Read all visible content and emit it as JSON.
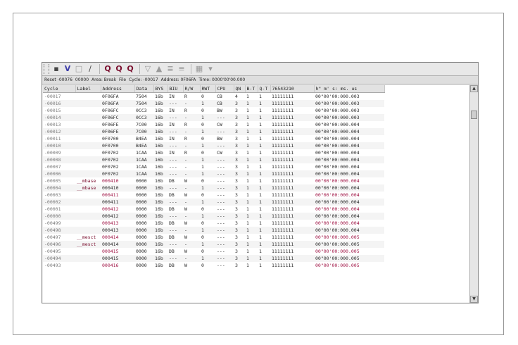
{
  "toolbar": {
    "items": [
      {
        "name": "pointer-tool-icon",
        "glyph": "▪",
        "cls": "",
        "interactable": true
      },
      {
        "name": "v-tool-icon",
        "glyph": "V",
        "cls": "v",
        "interactable": true
      },
      {
        "name": "page-icon",
        "glyph": "□",
        "cls": "dis",
        "interactable": true
      },
      {
        "name": "pencil-icon",
        "glyph": "∕",
        "cls": "",
        "interactable": true
      },
      {
        "sep": true
      },
      {
        "name": "search-icon",
        "glyph": "Q",
        "cls": "mag",
        "interactable": true
      },
      {
        "name": "search-prev-icon",
        "glyph": "Q",
        "cls": "mag",
        "interactable": true
      },
      {
        "name": "search-next-icon",
        "glyph": "Q",
        "cls": "mag",
        "interactable": true
      },
      {
        "sep": true
      },
      {
        "name": "filter-down-icon",
        "glyph": "▽",
        "cls": "dis",
        "interactable": true
      },
      {
        "name": "triangle-up-icon",
        "glyph": "▲",
        "cls": "dis",
        "interactable": true
      },
      {
        "name": "filter-lines-icon",
        "glyph": "≣",
        "cls": "dis",
        "interactable": true
      },
      {
        "name": "list-icon",
        "glyph": "≡",
        "cls": "dis",
        "interactable": true
      },
      {
        "sep": true
      },
      {
        "name": "grid-icon",
        "glyph": "▦",
        "cls": "dis",
        "interactable": true
      },
      {
        "name": "dropdown-icon",
        "glyph": "▾",
        "cls": "dis",
        "interactable": true
      }
    ]
  },
  "status": [
    "Reset -00076",
    "00000",
    "Area: Break",
    "File",
    "Cycle: -00017",
    "Address: 0F06FA",
    "Time: 0000'00'00.000"
  ],
  "columns": [
    "Cycle",
    "Label",
    "Address",
    "Data",
    "BYS",
    "BIU",
    "R/W",
    "RWT",
    "CPU",
    "QN",
    "B-T",
    "Q-T",
    "76543210",
    "h\" m' s: ms. us"
  ],
  "rows": [
    {
      "cycle": "-00017",
      "label": "",
      "address": "0F06FA",
      "data": "7504",
      "bys": "16b",
      "biu": "IN",
      "rw": "R",
      "rwt": "0",
      "cpu": "CB",
      "qn": "4",
      "bt": "1",
      "qt": "1",
      "bits": "11111111",
      "time": "00\"00'00:000.003",
      "hl": false
    },
    {
      "cycle": "-00016",
      "label": "",
      "address": "0F06FA",
      "data": "7504",
      "bys": "16b",
      "biu": "---",
      "rw": "-",
      "rwt": "1",
      "cpu": "CB",
      "qn": "3",
      "bt": "1",
      "qt": "1",
      "bits": "11111111",
      "time": "00\"00'00:000.003",
      "hl": false
    },
    {
      "cycle": "-00015",
      "label": "",
      "address": "0F06FC",
      "data": "0CC3",
      "bys": "16b",
      "biu": "IN",
      "rw": "R",
      "rwt": "0",
      "cpu": "BW",
      "qn": "3",
      "bt": "1",
      "qt": "1",
      "bits": "11111111",
      "time": "00\"00'00:000.003",
      "hl": false
    },
    {
      "cycle": "-00014",
      "label": "",
      "address": "0F06FC",
      "data": "0CC3",
      "bys": "16b",
      "biu": "---",
      "rw": "-",
      "rwt": "1",
      "cpu": "---",
      "qn": "3",
      "bt": "1",
      "qt": "1",
      "bits": "11111111",
      "time": "00\"00'00:000.003",
      "hl": false
    },
    {
      "cycle": "-00013",
      "label": "",
      "address": "0F06FE",
      "data": "7C00",
      "bys": "16b",
      "biu": "IN",
      "rw": "R",
      "rwt": "0",
      "cpu": "CW",
      "qn": "3",
      "bt": "1",
      "qt": "1",
      "bits": "11111111",
      "time": "00\"00'00:000.004",
      "hl": false
    },
    {
      "cycle": "-00012",
      "label": "",
      "address": "0F06FE",
      "data": "7C00",
      "bys": "16b",
      "biu": "---",
      "rw": "-",
      "rwt": "1",
      "cpu": "---",
      "qn": "3",
      "bt": "1",
      "qt": "1",
      "bits": "11111111",
      "time": "00\"00'00:000.004",
      "hl": false
    },
    {
      "cycle": "-00011",
      "label": "",
      "address": "0F0700",
      "data": "B4EA",
      "bys": "16b",
      "biu": "IN",
      "rw": "R",
      "rwt": "0",
      "cpu": "BW",
      "qn": "3",
      "bt": "1",
      "qt": "1",
      "bits": "11111111",
      "time": "00\"00'00:000.004",
      "hl": false
    },
    {
      "cycle": "-00010",
      "label": "",
      "address": "0F0700",
      "data": "B4EA",
      "bys": "16b",
      "biu": "---",
      "rw": "-",
      "rwt": "1",
      "cpu": "---",
      "qn": "3",
      "bt": "1",
      "qt": "1",
      "bits": "11111111",
      "time": "00\"00'00:000.004",
      "hl": false
    },
    {
      "cycle": "-00009",
      "label": "",
      "address": "0F0702",
      "data": "1CAA",
      "bys": "16b",
      "biu": "IN",
      "rw": "R",
      "rwt": "0",
      "cpu": "CW",
      "qn": "3",
      "bt": "1",
      "qt": "1",
      "bits": "11111111",
      "time": "00\"00'00:000.004",
      "hl": false
    },
    {
      "cycle": "-00008",
      "label": "",
      "address": "0F0702",
      "data": "1CAA",
      "bys": "16b",
      "biu": "---",
      "rw": "-",
      "rwt": "1",
      "cpu": "---",
      "qn": "3",
      "bt": "1",
      "qt": "1",
      "bits": "11111111",
      "time": "00\"00'00:000.004",
      "hl": false
    },
    {
      "cycle": "-00007",
      "label": "",
      "address": "0F0702",
      "data": "1CAA",
      "bys": "16b",
      "biu": "---",
      "rw": "-",
      "rwt": "1",
      "cpu": "---",
      "qn": "3",
      "bt": "1",
      "qt": "1",
      "bits": "11111111",
      "time": "00\"00'00:000.004",
      "hl": false
    },
    {
      "cycle": "-00006",
      "label": "",
      "address": "0F0702",
      "data": "1CAA",
      "bys": "16b",
      "biu": "---",
      "rw": "-",
      "rwt": "1",
      "cpu": "---",
      "qn": "3",
      "bt": "1",
      "qt": "1",
      "bits": "11111111",
      "time": "00\"00'00:000.004",
      "hl": false
    },
    {
      "cycle": "-00005",
      "label": "__mbase",
      "address": "000410",
      "data": "0000",
      "bys": "16b",
      "biu": "DB",
      "rw": "W",
      "rwt": "0",
      "cpu": "---",
      "qn": "3",
      "bt": "1",
      "qt": "1",
      "bits": "11111111",
      "time": "00\"00'00:000.004",
      "hl": true
    },
    {
      "cycle": "-00004",
      "label": "__mbase",
      "address": "000410",
      "data": "0000",
      "bys": "16b",
      "biu": "---",
      "rw": "-",
      "rwt": "1",
      "cpu": "---",
      "qn": "3",
      "bt": "1",
      "qt": "1",
      "bits": "11111111",
      "time": "00\"00'00:000.004",
      "hl": false
    },
    {
      "cycle": "-00003",
      "label": "",
      "address": "000411",
      "data": "0000",
      "bys": "16b",
      "biu": "DB",
      "rw": "W",
      "rwt": "0",
      "cpu": "---",
      "qn": "3",
      "bt": "1",
      "qt": "1",
      "bits": "11111111",
      "time": "00\"00'00:000.004",
      "hl": true
    },
    {
      "cycle": "-00002",
      "label": "",
      "address": "000411",
      "data": "0000",
      "bys": "16b",
      "biu": "---",
      "rw": "-",
      "rwt": "1",
      "cpu": "---",
      "qn": "3",
      "bt": "1",
      "qt": "1",
      "bits": "11111111",
      "time": "00\"00'00:000.004",
      "hl": false
    },
    {
      "cycle": "-00001",
      "label": "",
      "address": "000412",
      "data": "0000",
      "bys": "16b",
      "biu": "DB",
      "rw": "W",
      "rwt": "0",
      "cpu": "---",
      "qn": "3",
      "bt": "1",
      "qt": "1",
      "bits": "11111111",
      "time": "00\"00'00:000.004",
      "hl": true
    },
    {
      "cycle": "-00000",
      "label": "",
      "address": "000412",
      "data": "0000",
      "bys": "16b",
      "biu": "---",
      "rw": "-",
      "rwt": "1",
      "cpu": "---",
      "qn": "3",
      "bt": "1",
      "qt": "1",
      "bits": "11111111",
      "time": "00\"00'00:000.004",
      "hl": false
    },
    {
      "cycle": "-00499",
      "label": "",
      "address": "000413",
      "data": "0000",
      "bys": "16b",
      "biu": "DB",
      "rw": "W",
      "rwt": "0",
      "cpu": "---",
      "qn": "3",
      "bt": "1",
      "qt": "1",
      "bits": "11111111",
      "time": "00\"00'00:000.004",
      "hl": true
    },
    {
      "cycle": "-00498",
      "label": "",
      "address": "000413",
      "data": "0000",
      "bys": "16b",
      "biu": "---",
      "rw": "-",
      "rwt": "1",
      "cpu": "---",
      "qn": "3",
      "bt": "1",
      "qt": "1",
      "bits": "11111111",
      "time": "00\"00'00:000.004",
      "hl": false
    },
    {
      "cycle": "-00497",
      "label": "__mesct",
      "address": "000414",
      "data": "0000",
      "bys": "16b",
      "biu": "DB",
      "rw": "W",
      "rwt": "0",
      "cpu": "---",
      "qn": "3",
      "bt": "1",
      "qt": "1",
      "bits": "11111111",
      "time": "00\"00'00:000.005",
      "hl": true
    },
    {
      "cycle": "-00496",
      "label": "__mesct",
      "address": "000414",
      "data": "0000",
      "bys": "16b",
      "biu": "---",
      "rw": "-",
      "rwt": "1",
      "cpu": "---",
      "qn": "3",
      "bt": "1",
      "qt": "1",
      "bits": "11111111",
      "time": "00\"00'00:000.005",
      "hl": false
    },
    {
      "cycle": "-00495",
      "label": "",
      "address": "000415",
      "data": "0000",
      "bys": "16b",
      "biu": "DB",
      "rw": "W",
      "rwt": "0",
      "cpu": "---",
      "qn": "3",
      "bt": "1",
      "qt": "1",
      "bits": "11111111",
      "time": "00\"00'00:000.005",
      "hl": true
    },
    {
      "cycle": "-00494",
      "label": "",
      "address": "000415",
      "data": "0000",
      "bys": "16b",
      "biu": "---",
      "rw": "-",
      "rwt": "1",
      "cpu": "---",
      "qn": "3",
      "bt": "1",
      "qt": "1",
      "bits": "11111111",
      "time": "00\"00'00:000.005",
      "hl": false
    },
    {
      "cycle": "-00493",
      "label": "",
      "address": "000416",
      "data": "0000",
      "bys": "16b",
      "biu": "DB",
      "rw": "W",
      "rwt": "0",
      "cpu": "---",
      "qn": "3",
      "bt": "1",
      "qt": "1",
      "bits": "11111111",
      "time": "00\"00'00:000.005",
      "hl": true
    }
  ],
  "scrollbar": {
    "up": "▲",
    "down": "▼"
  }
}
